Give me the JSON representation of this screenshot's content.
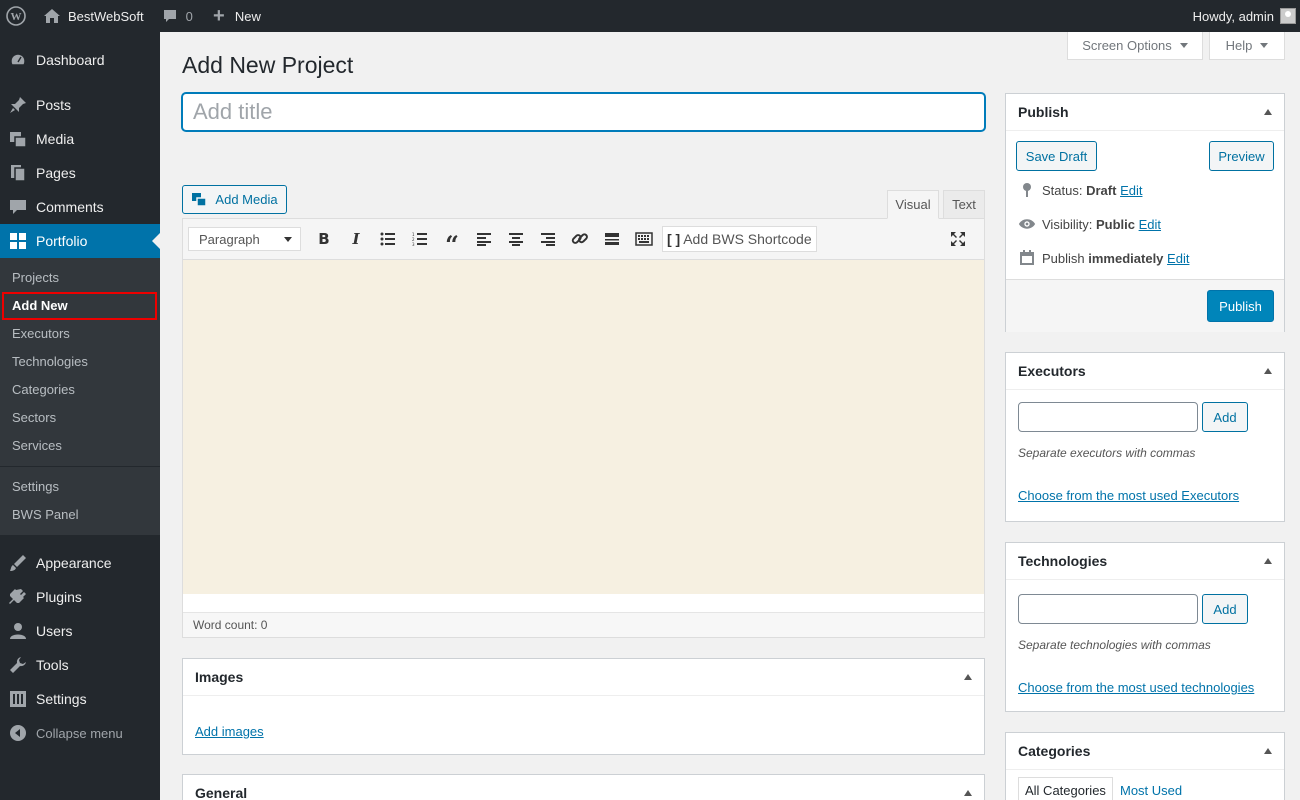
{
  "adminbar": {
    "site_name": "BestWebSoft",
    "comments_count": "0",
    "new_label": "New",
    "greeting": "Howdy, admin"
  },
  "sidebar": {
    "items_top": [
      {
        "label": "Dashboard",
        "icon": "dashboard-icon"
      },
      {
        "label": "Posts",
        "icon": "pin-icon"
      },
      {
        "label": "Media",
        "icon": "media-icon"
      },
      {
        "label": "Pages",
        "icon": "pages-icon"
      },
      {
        "label": "Comments",
        "icon": "comments-icon"
      },
      {
        "label": "Portfolio",
        "icon": "portfolio-icon"
      }
    ],
    "submenu": [
      "Projects",
      "Add New",
      "Executors",
      "Technologies",
      "Categories",
      "Sectors",
      "Services",
      "Settings",
      "BWS Panel"
    ],
    "items_bottom": [
      {
        "label": "Appearance",
        "icon": "appearance-icon"
      },
      {
        "label": "Plugins",
        "icon": "plugins-icon"
      },
      {
        "label": "Users",
        "icon": "users-icon"
      },
      {
        "label": "Tools",
        "icon": "tools-icon"
      },
      {
        "label": "Settings",
        "icon": "settings-icon"
      },
      {
        "label": "Collapse menu",
        "icon": "collapse-icon"
      }
    ]
  },
  "screen_meta": {
    "screen_options": "Screen Options",
    "help": "Help"
  },
  "page_title": "Add New Project",
  "title_placeholder": "Add title",
  "editor": {
    "add_media": "Add Media",
    "tab_visual": "Visual",
    "tab_text": "Text",
    "format": "Paragraph",
    "bws_shortcode": "Add BWS Shortcode",
    "word_count": "Word count: 0"
  },
  "images_box": {
    "title": "Images",
    "link": "Add images"
  },
  "general_box": {
    "title": "General"
  },
  "publish": {
    "title": "Publish",
    "save_draft": "Save Draft",
    "preview": "Preview",
    "status_label": "Status:",
    "status_value": "Draft",
    "visibility_label": "Visibility:",
    "visibility_value": "Public",
    "publish_label": "Publish",
    "publish_value": "immediately",
    "edit": "Edit",
    "publish_button": "Publish"
  },
  "executors": {
    "title": "Executors",
    "add": "Add",
    "hint": "Separate executors with commas",
    "link": "Choose from the most used Executors"
  },
  "technologies": {
    "title": "Technologies",
    "add": "Add",
    "hint": "Separate technologies with commas",
    "link": "Choose from the most used technologies"
  },
  "categories": {
    "title": "Categories",
    "tab_all": "All Categories",
    "tab_most_used": "Most Used"
  },
  "colors": {
    "accent": "#0073aa",
    "sidebar": "#23282d",
    "highlight": "#e00000"
  }
}
